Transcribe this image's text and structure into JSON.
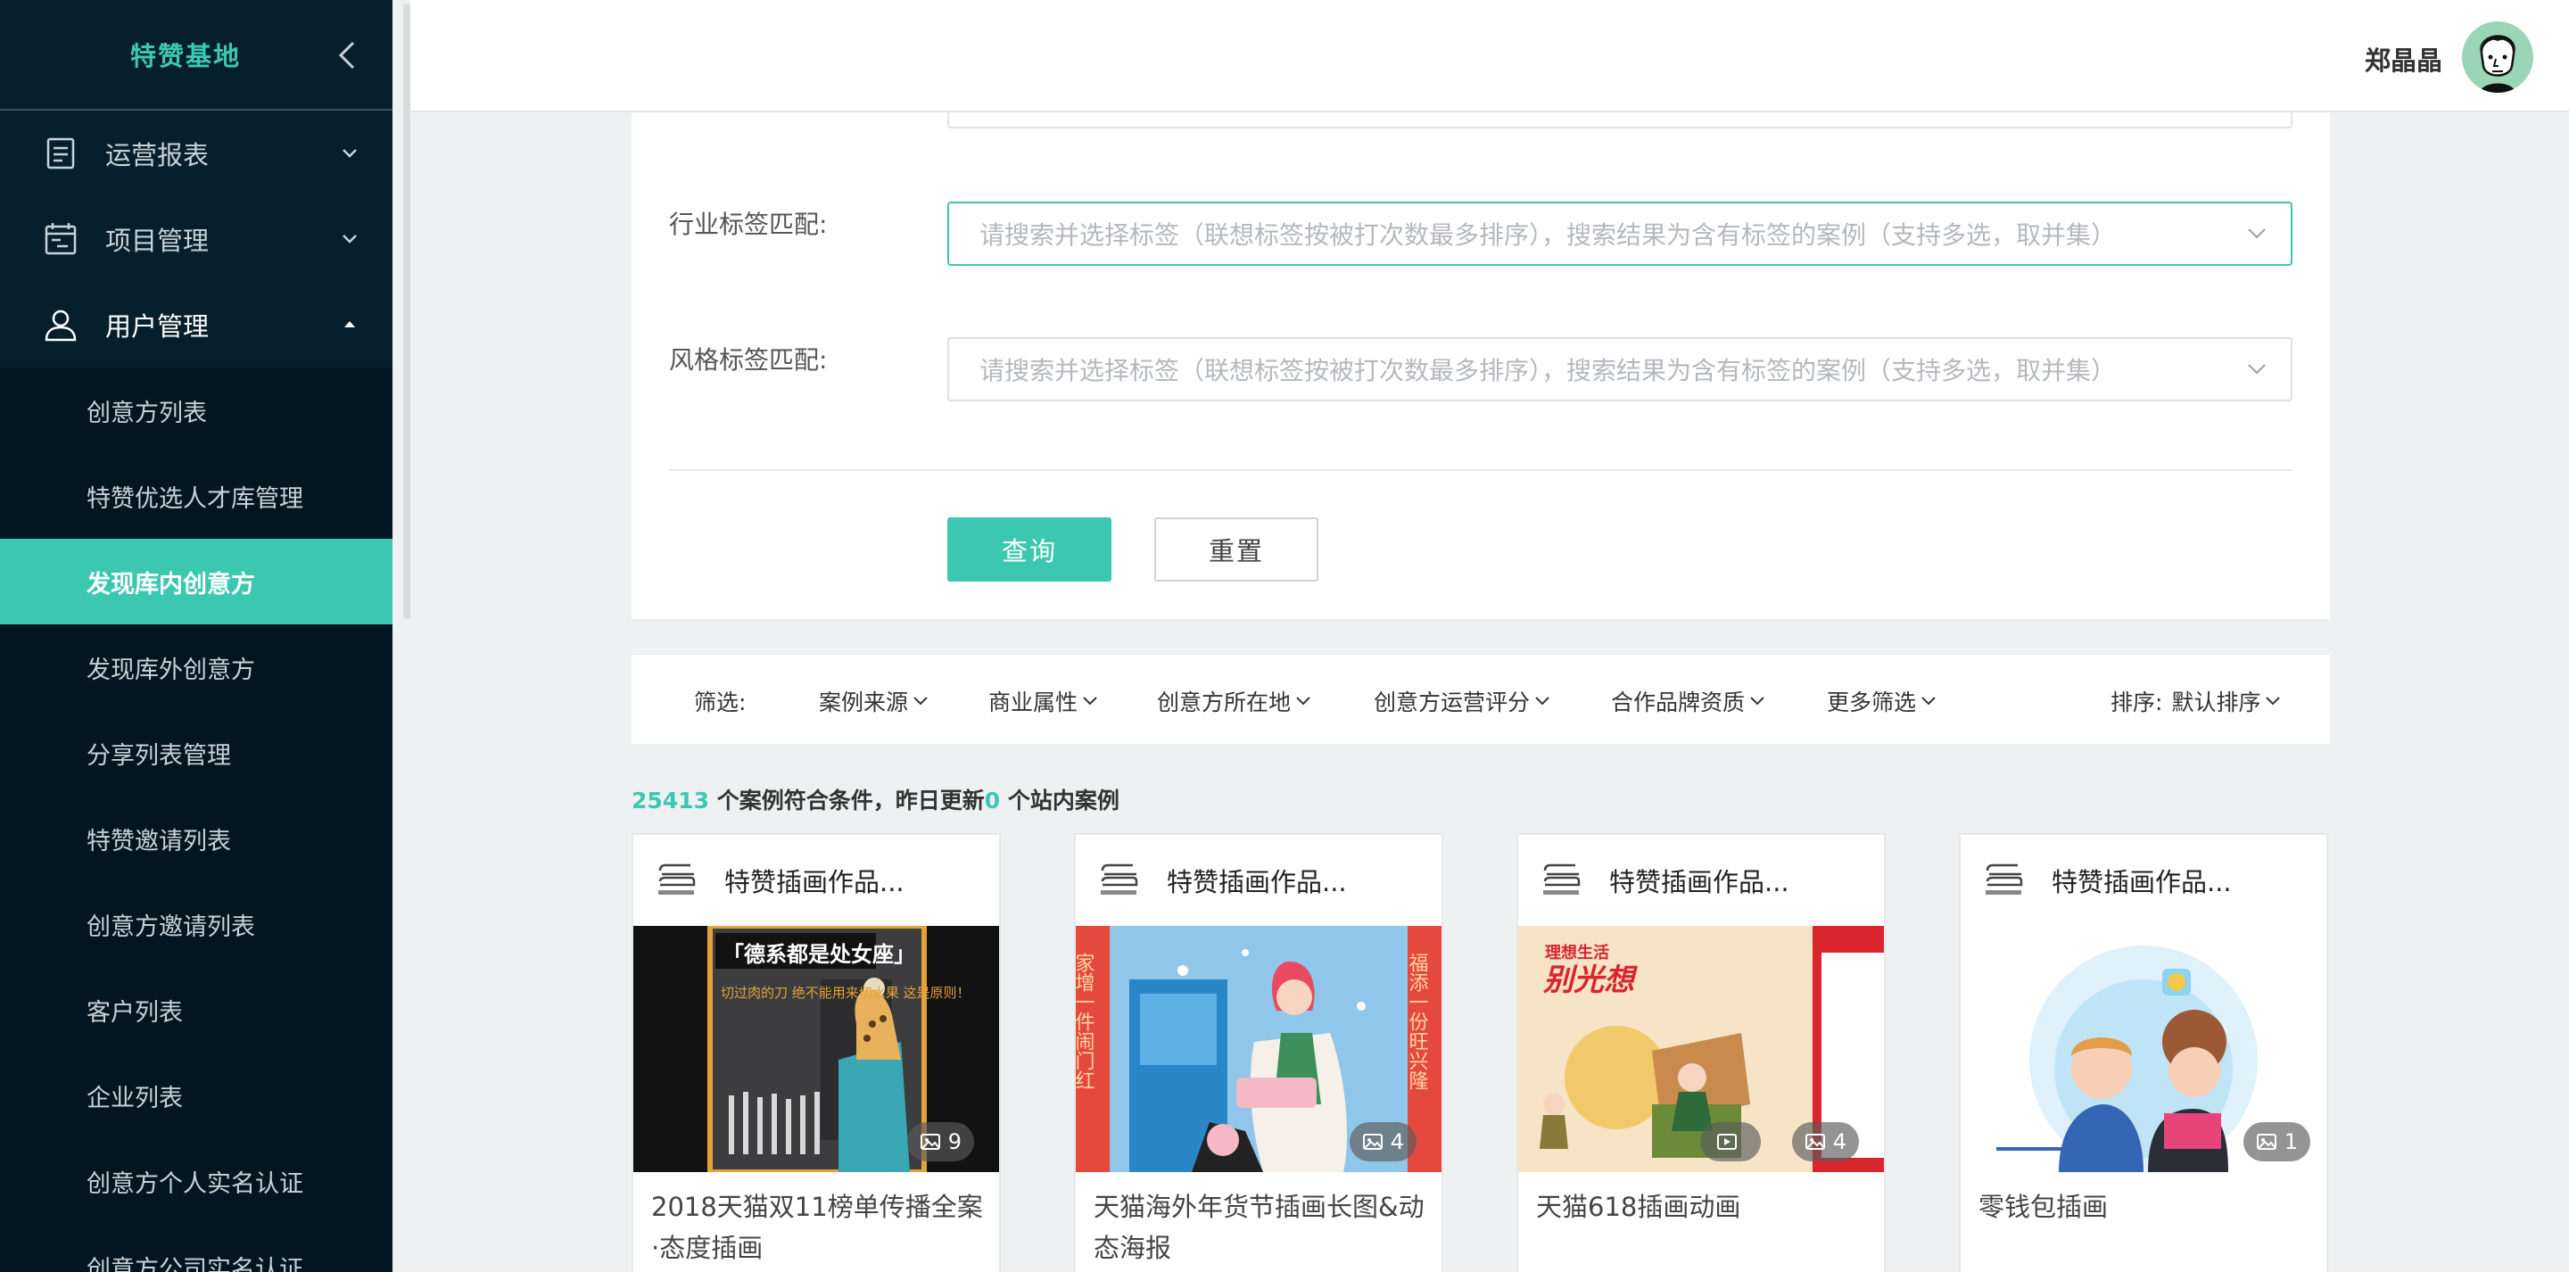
{
  "sidebar": {
    "brand": "特赞基地",
    "menus": [
      {
        "label": "运营报表"
      },
      {
        "label": "项目管理"
      },
      {
        "label": "用户管理"
      }
    ],
    "sub_items": [
      {
        "label": "创意方列表"
      },
      {
        "label": "特赞优选人才库管理"
      },
      {
        "label": "发现库内创意方"
      },
      {
        "label": "发现库外创意方"
      },
      {
        "label": "分享列表管理"
      },
      {
        "label": "特赞邀请列表"
      },
      {
        "label": "创意方邀请列表"
      },
      {
        "label": "客户列表"
      },
      {
        "label": "企业列表"
      },
      {
        "label": "创意方个人实名认证"
      },
      {
        "label": "创意方公司实名认证"
      }
    ]
  },
  "header": {
    "username": "郑晶晶"
  },
  "search_panel": {
    "industry_label": "行业标签匹配:",
    "industry_placeholder": "请搜索并选择标签（联想标签按被打次数最多排序），搜索结果为含有标签的案例（支持多选，取并集）",
    "style_label": "风格标签匹配:",
    "style_placeholder": "请搜索并选择标签（联想标签按被打次数最多排序），搜索结果为含有标签的案例（支持多选，取并集）",
    "query_button": "查询",
    "reset_button": "重置"
  },
  "filter_bar": {
    "label": "筛选:",
    "filters": [
      "案例来源",
      "商业属性",
      "创意方所在地",
      "创意方运营评分",
      "合作品牌资质",
      "更多筛选"
    ],
    "sort_label": "排序:",
    "sort_value": "默认排序"
  },
  "summary": {
    "count": "25413",
    "text_a": " 个案例符合条件，昨日更新",
    "updated": "0",
    "text_b": " 个站内案例"
  },
  "cards": [
    {
      "title": "特赞插画作品...",
      "caption": "2018天猫双11榜单传播全案·态度插画",
      "image_count": "9",
      "img_text": "「德系都是处女座」",
      "img_sub": "切过肉的刀 绝不能用来切水果 这是原则！"
    },
    {
      "title": "特赞插画作品...",
      "caption": "天猫海外年货节插画长图&动态海报",
      "image_count": "4",
      "img_left": "家增一件闹门红",
      "img_right": "福添一份旺兴隆"
    },
    {
      "title": "特赞插画作品...",
      "caption": "天猫618插画动画",
      "image_count": "4",
      "img_brand": "理想生活",
      "img_head": "别光想"
    },
    {
      "title": "特赞插画作品...",
      "caption": "零钱包插画",
      "image_count": "1"
    }
  ],
  "colors": {
    "accent": "#3cc8b0",
    "sidebar_bg": "#071f2d",
    "submenu_bg": "#031520"
  }
}
